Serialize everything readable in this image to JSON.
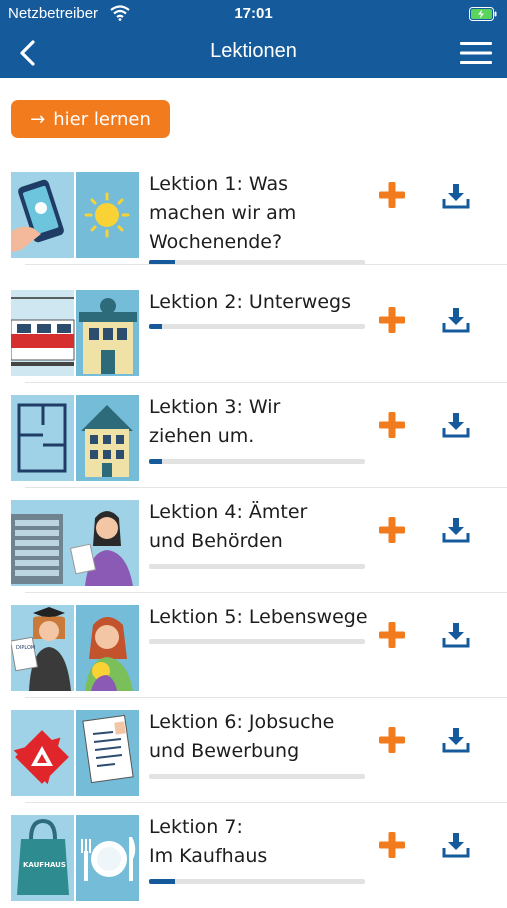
{
  "status_bar": {
    "carrier": "Netzbetreiber",
    "time": "17:01",
    "icons": [
      "wifi-icon",
      "battery-charging-icon"
    ]
  },
  "nav": {
    "title": "Lektionen",
    "back_icon": "chevron-left-icon",
    "menu_icon": "hamburger-menu-icon"
  },
  "learn_button": {
    "arrow": "→",
    "label": "hier lernen"
  },
  "colors": {
    "brand_blue": "#155b9c",
    "accent_orange": "#f27b1d",
    "progress_track": "#e2e2e2"
  },
  "lessons": [
    {
      "title_lines": [
        "Lektion 1: Was",
        "machen wir am",
        "Wochenende?"
      ],
      "progress": 0.12
    },
    {
      "title_lines": [
        "Lektion 2: Unterwegs"
      ],
      "progress": 0.06
    },
    {
      "title_lines": [
        "Lektion 3: Wir",
        "ziehen um."
      ],
      "progress": 0.06
    },
    {
      "title_lines": [
        "Lektion 4: Ämter",
        "und Behörden"
      ],
      "progress": 0.0
    },
    {
      "title_lines": [
        "Lektion 5: Lebenswege"
      ],
      "progress": 0.0
    },
    {
      "title_lines": [
        "Lektion 6: Jobsuche",
        "und Bewerbung"
      ],
      "progress": 0.0
    },
    {
      "title_lines": [
        "Lektion 7:",
        "Im Kaufhaus"
      ],
      "progress": 0.12
    }
  ],
  "thumb_texts": {
    "diplom": "DIPLOM",
    "kaufhaus": "KAUFHAUS"
  }
}
